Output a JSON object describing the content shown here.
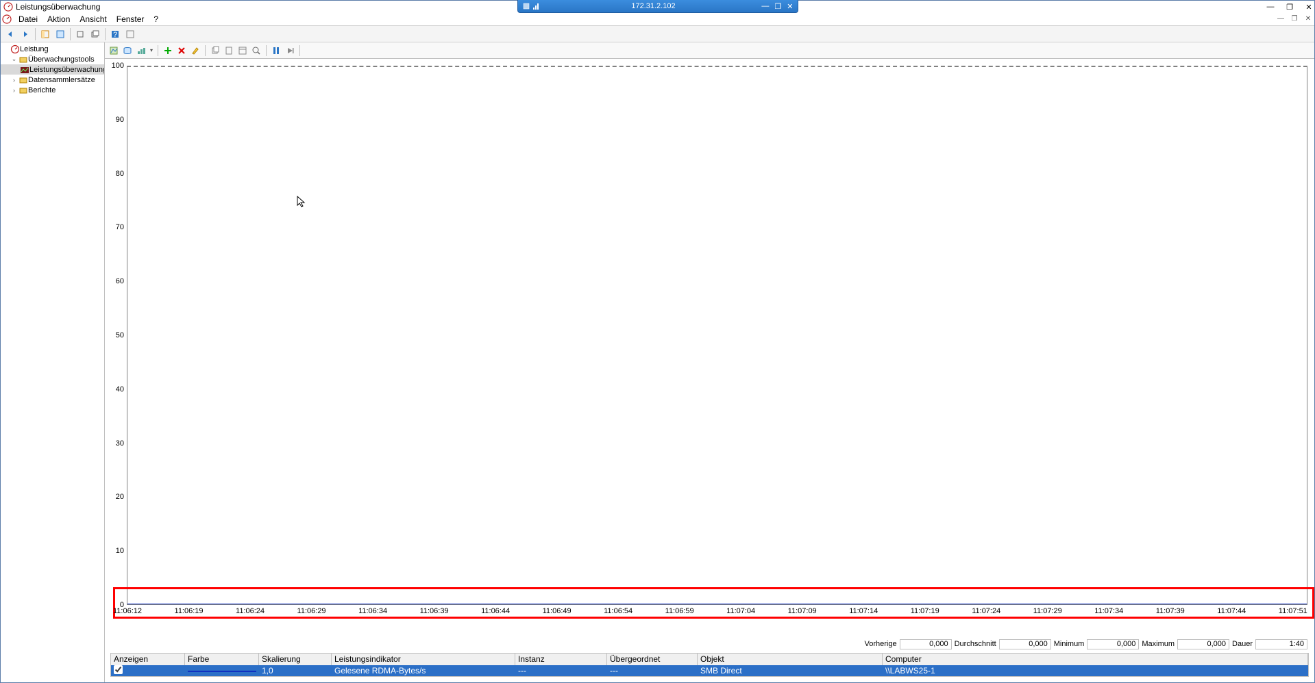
{
  "remote_bar": {
    "ip": "172.31.2.102"
  },
  "window": {
    "title": "Leistungsüberwachung"
  },
  "menu": {
    "items": [
      "Datei",
      "Aktion",
      "Ansicht",
      "Fenster",
      "?"
    ]
  },
  "tree": {
    "root": "Leistung",
    "tools": "Überwachungstools",
    "perfmon": "Leistungsüberwachung",
    "dcs": "Datensammlersätze",
    "reports": "Berichte"
  },
  "chart_data": {
    "type": "line",
    "ylim": [
      0,
      100
    ],
    "yticks": [
      100,
      90,
      80,
      70,
      60,
      50,
      40,
      30,
      20,
      10,
      0
    ],
    "xticks": [
      "11:06:12",
      "11:06:19",
      "11:06:24",
      "11:06:29",
      "11:06:34",
      "11:06:39",
      "11:06:44",
      "11:06:49",
      "11:06:54",
      "11:06:59",
      "11:07:04",
      "11:07:09",
      "11:07:14",
      "11:07:19",
      "11:07:24",
      "11:07:29",
      "11:07:34",
      "11:07:39",
      "11:07:44",
      "11:07:51"
    ],
    "series": [
      {
        "name": "Gelesene RDMA-Bytes/s",
        "color": "#1030c0",
        "values_all_zero": true
      }
    ]
  },
  "stats": {
    "vorherige_label": "Vorherige",
    "vorherige": "0,000",
    "durchschnitt_label": "Durchschnitt",
    "durchschnitt": "0,000",
    "minimum_label": "Minimum",
    "minimum": "0,000",
    "maximum_label": "Maximum",
    "maximum": "0,000",
    "dauer_label": "Dauer",
    "dauer": "1:40"
  },
  "table": {
    "headers": {
      "show": "Anzeigen",
      "color": "Farbe",
      "scale": "Skalierung",
      "counter": "Leistungsindikator",
      "instance": "Instanz",
      "parent": "Übergeordnet",
      "object": "Objekt",
      "computer": "Computer"
    },
    "row": {
      "scale": "1,0",
      "counter": "Gelesene RDMA-Bytes/s",
      "instance": "---",
      "parent": "---",
      "object": "SMB Direct",
      "computer": "\\\\LABWS25-1"
    }
  }
}
